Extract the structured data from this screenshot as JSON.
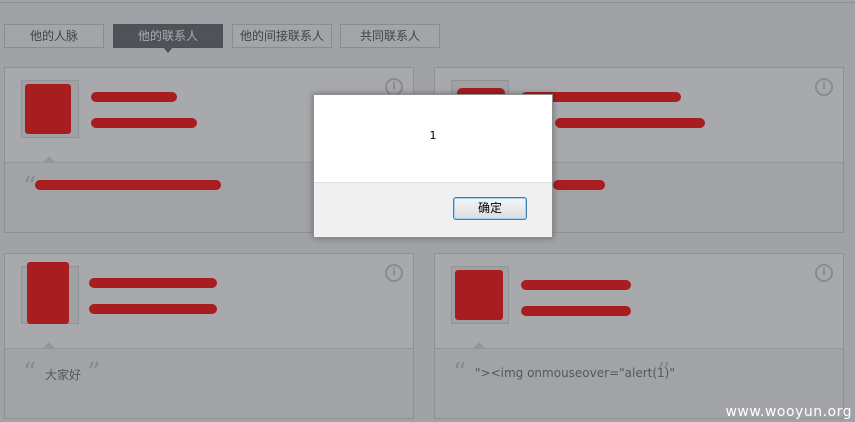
{
  "tabs": [
    {
      "label": "他的人脉"
    },
    {
      "label": "他的联系人"
    },
    {
      "label": "他的间接联系人"
    },
    {
      "label": "共同联系人"
    }
  ],
  "cards": [
    {
      "quote": ""
    },
    {
      "quote": ""
    },
    {
      "quote": "大家好"
    },
    {
      "quote": "\"><img onmouseover=\"alert(1)\""
    }
  ],
  "dialog": {
    "message": "1",
    "ok_label": "确定"
  },
  "info_glyph": "i",
  "quote_open": "“",
  "quote_close": "”",
  "watermark": "www.wooyun.org",
  "colors": {
    "redaction": "#ff0000",
    "active_tab": "#5f6368",
    "dialog_button_border": "#3c7fb1"
  }
}
